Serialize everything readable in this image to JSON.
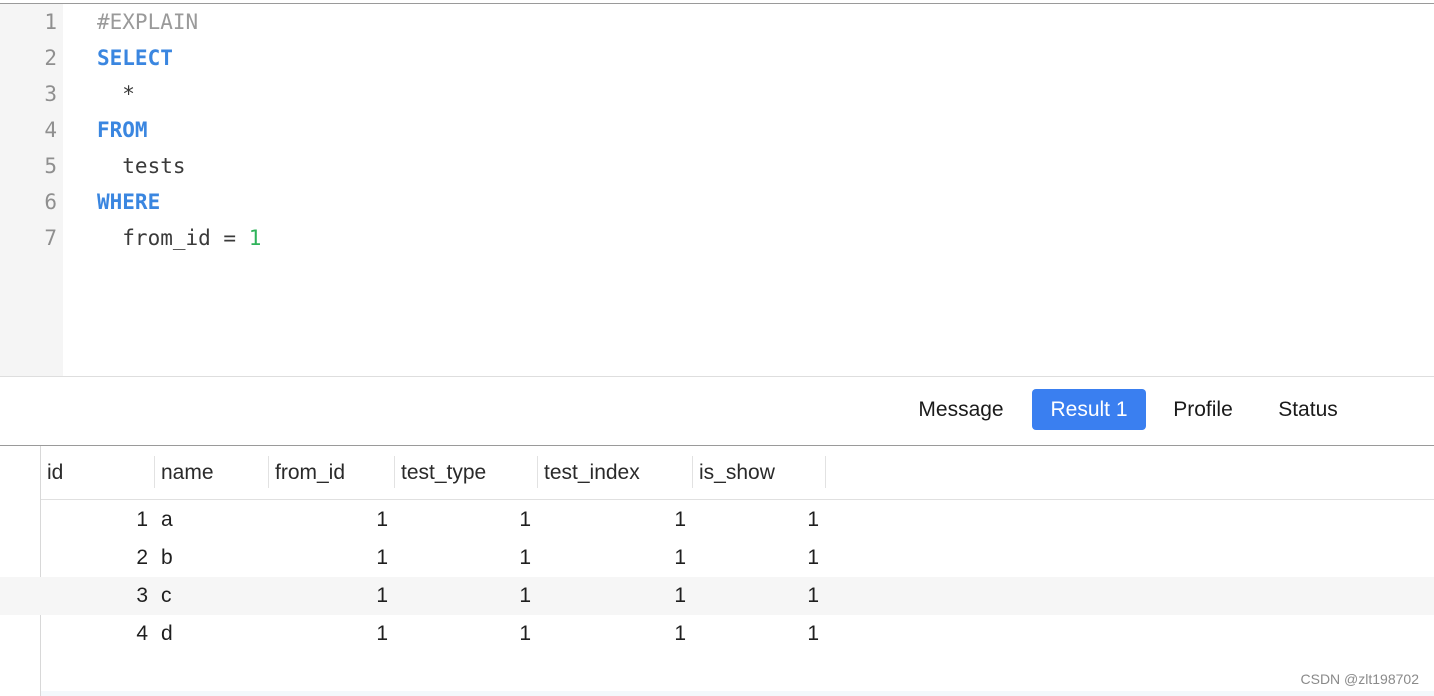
{
  "editor": {
    "lines": [
      {
        "num": "1",
        "tokens": [
          {
            "text": "#EXPLAIN",
            "type": "comment"
          }
        ]
      },
      {
        "num": "2",
        "tokens": [
          {
            "text": "SELECT",
            "type": "keyword"
          }
        ]
      },
      {
        "num": "3",
        "tokens": [
          {
            "text": "  *",
            "type": "ident"
          }
        ]
      },
      {
        "num": "4",
        "tokens": [
          {
            "text": "FROM",
            "type": "keyword"
          }
        ]
      },
      {
        "num": "5",
        "tokens": [
          {
            "text": "  tests",
            "type": "ident"
          }
        ]
      },
      {
        "num": "6",
        "tokens": [
          {
            "text": "WHERE",
            "type": "keyword"
          }
        ]
      },
      {
        "num": "7",
        "tokens": [
          {
            "text": "  from_id = ",
            "type": "ident"
          },
          {
            "text": "1",
            "type": "number"
          }
        ]
      }
    ]
  },
  "tabs": [
    {
      "label": "Message",
      "active": false
    },
    {
      "label": "Result 1",
      "active": true
    },
    {
      "label": "Profile",
      "active": false
    },
    {
      "label": "Status",
      "active": false
    }
  ],
  "grid": {
    "columns": [
      "id",
      "name",
      "from_id",
      "test_type",
      "test_index",
      "is_show"
    ],
    "rows": [
      [
        "1",
        "a",
        "1",
        "1",
        "1",
        "1"
      ],
      [
        "2",
        "b",
        "1",
        "1",
        "1",
        "1"
      ],
      [
        "3",
        "c",
        "1",
        "1",
        "1",
        "1"
      ],
      [
        "4",
        "d",
        "1",
        "1",
        "1",
        "1"
      ]
    ]
  },
  "watermark": "CSDN @zlt198702",
  "colors": {
    "keyword": "#3a86e0",
    "number": "#2fb35a",
    "comment": "#9a9a9a",
    "active_tab": "#3a7ff0"
  }
}
